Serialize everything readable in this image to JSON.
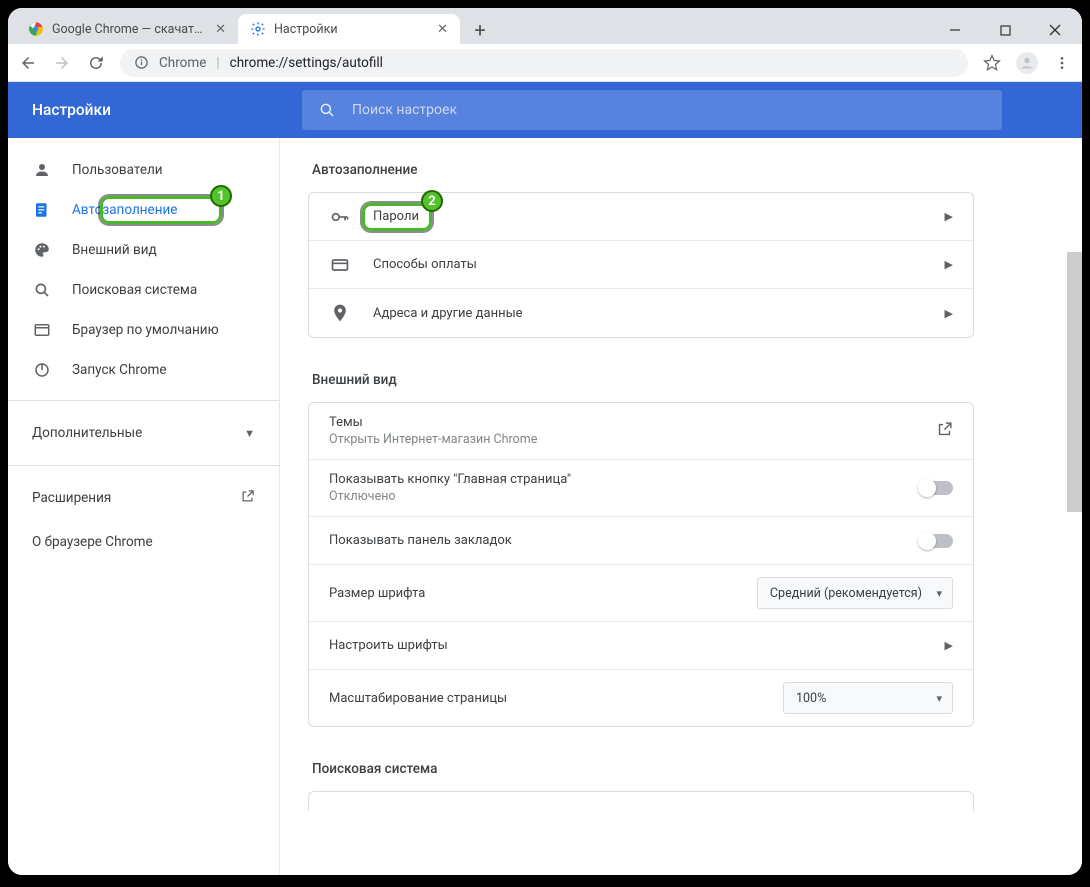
{
  "window": {
    "tabs": [
      {
        "title": "Google Chrome — скачать бесп"
      },
      {
        "title": "Настройки"
      }
    ],
    "url_prefix": "Chrome",
    "url": "chrome://settings/autofill"
  },
  "header": {
    "title": "Настройки",
    "search_placeholder": "Поиск настроек"
  },
  "sidebar": {
    "items": [
      {
        "icon": "person",
        "label": "Пользователи"
      },
      {
        "icon": "autofill",
        "label": "Автозаполнение",
        "active": true
      },
      {
        "icon": "palette",
        "label": "Внешний вид"
      },
      {
        "icon": "search",
        "label": "Поисковая система"
      },
      {
        "icon": "browser",
        "label": "Браузер по умолчанию"
      },
      {
        "icon": "power",
        "label": "Запуск Chrome"
      }
    ],
    "advanced": "Дополнительные",
    "extensions": "Расширения",
    "about": "О браузере Chrome"
  },
  "annotations": {
    "badge1": "1",
    "badge2": "2"
  },
  "sections": {
    "autofill": {
      "title": "Автозаполнение",
      "rows": [
        {
          "icon": "key",
          "label": "Пароли"
        },
        {
          "icon": "card",
          "label": "Способы оплаты"
        },
        {
          "icon": "pin",
          "label": "Адреса и другие данные"
        }
      ]
    },
    "appearance": {
      "title": "Внешний вид",
      "themes_label": "Темы",
      "themes_sub": "Открыть Интернет-магазин Chrome",
      "home_button": "Показывать кнопку \"Главная страница\"",
      "home_button_sub": "Отключено",
      "bookmarks_bar": "Показывать панель закладок",
      "font_size_label": "Размер шрифта",
      "font_size_value": "Средний (рекомендуется)",
      "customize_fonts": "Настроить шрифты",
      "zoom_label": "Масштабирование страницы",
      "zoom_value": "100%"
    },
    "search_engine": {
      "title": "Поисковая система"
    }
  }
}
